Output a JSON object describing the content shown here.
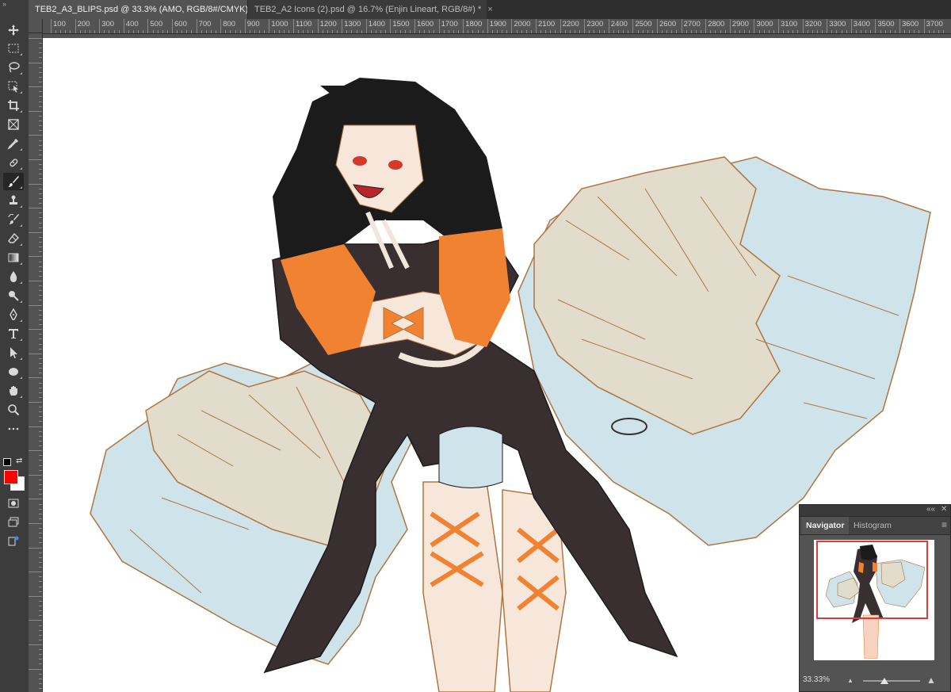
{
  "toolbar": {
    "collapse_glyph": "»",
    "tools": [
      {
        "name": "move-tool-icon"
      },
      {
        "name": "marquee-tool-icon"
      },
      {
        "name": "lasso-tool-icon"
      },
      {
        "name": "object-select-tool-icon"
      },
      {
        "name": "crop-tool-icon"
      },
      {
        "name": "frame-tool-icon"
      },
      {
        "name": "eyedropper-tool-icon"
      },
      {
        "name": "healing-brush-tool-icon"
      },
      {
        "name": "brush-tool-icon",
        "active": true
      },
      {
        "name": "clone-stamp-tool-icon"
      },
      {
        "name": "history-brush-tool-icon"
      },
      {
        "name": "eraser-tool-icon"
      },
      {
        "name": "gradient-tool-icon"
      },
      {
        "name": "blur-tool-icon"
      },
      {
        "name": "dodge-tool-icon"
      },
      {
        "name": "pen-tool-icon"
      },
      {
        "name": "type-tool-icon"
      },
      {
        "name": "path-select-tool-icon"
      },
      {
        "name": "ellipse-tool-icon"
      },
      {
        "name": "hand-tool-icon"
      },
      {
        "name": "zoom-tool-icon"
      },
      {
        "name": "more-tools-icon"
      }
    ],
    "foreground_color": "#ff0000",
    "background_color": "#ffffff"
  },
  "tabs": [
    {
      "label": "TEB2_A3_BLIPS.psd @ 33.3% (AMO, RGB/8#/CMYK)",
      "close": "×",
      "active": true
    },
    {
      "label": "TEB2_A2 Icons (2).psd @ 16.7% (Enjin Lineart, RGB/8#) *",
      "close": "×",
      "active": false
    }
  ],
  "ruler_top": [
    "100",
    "200",
    "300",
    "400",
    "500",
    "600",
    "700",
    "800",
    "900",
    "1000",
    "1100",
    "1200",
    "1300",
    "1400",
    "1500",
    "1600",
    "1700",
    "1800",
    "1900",
    "2000",
    "2100",
    "2200",
    "2300",
    "2400",
    "2500",
    "2600",
    "2700",
    "2800",
    "2900",
    "3000",
    "3100",
    "3200",
    "3300",
    "3400",
    "3500",
    "3600",
    "3700"
  ],
  "navigator": {
    "tabs": [
      "Navigator",
      "Histogram"
    ],
    "collapse": "««",
    "close": "✕",
    "menu": "≡",
    "zoom": "33.33%",
    "view_color": "#e23a3a"
  },
  "colors": {
    "app_bg": "#535353",
    "hair_black": "#1b1b1b",
    "hair_orange": "#f08232",
    "dress": "#3a2f30",
    "wing_beige": "#e2dccd",
    "wing_blue": "#cfe3ea",
    "line_brown": "#b07540",
    "skin": "#f7e6da"
  }
}
